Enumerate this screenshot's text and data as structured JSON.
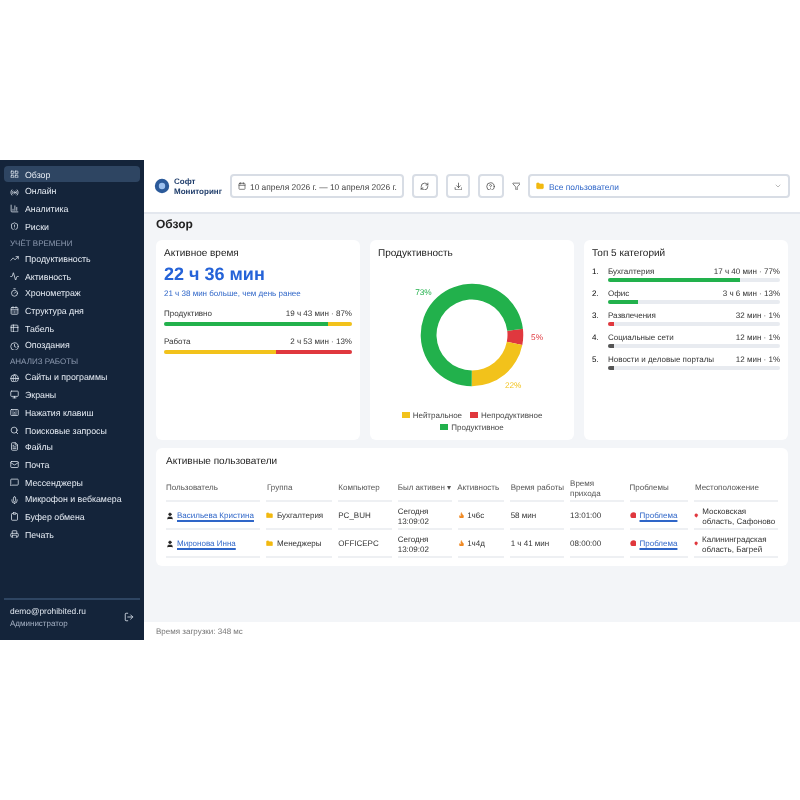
{
  "sidebar": {
    "items": [
      {
        "label": "Обзор",
        "selected": true
      },
      {
        "label": "Онлайн",
        "selected": false
      },
      {
        "label": "Аналитика",
        "selected": false
      },
      {
        "label": "Риски",
        "selected": false
      }
    ],
    "sections": [
      {
        "title": "УЧЁТ ВРЕМЕНИ",
        "items": [
          {
            "label": "Продуктивность",
            "selected": false
          },
          {
            "label": "Активность",
            "selected": false
          },
          {
            "label": "Хронометраж",
            "selected": false
          },
          {
            "label": "Структура дня",
            "selected": false
          },
          {
            "label": "Табель",
            "selected": false
          },
          {
            "label": "Опоздания",
            "selected": false
          }
        ]
      },
      {
        "title": "АНАЛИЗ РАБОТЫ",
        "items": [
          {
            "label": "Сайты и программы",
            "selected": false
          },
          {
            "label": "Экраны",
            "selected": false
          },
          {
            "label": "Нажатия клавиш",
            "selected": false
          },
          {
            "label": "Поисковые запросы",
            "selected": false
          },
          {
            "label": "Файлы",
            "selected": false
          },
          {
            "label": "Почта",
            "selected": false
          },
          {
            "label": "Мессенджеры",
            "selected": false
          },
          {
            "label": "Микрофон и вебкамера",
            "selected": false
          },
          {
            "label": "Буфер обмена",
            "selected": false
          },
          {
            "label": "Печать",
            "selected": false
          }
        ]
      }
    ],
    "user": {
      "email": "demo@prohibited.ru",
      "role": "Администратор"
    }
  },
  "toolbar": {
    "logo": [
      "Софт",
      "Мониторинг"
    ],
    "date_range": "10 апреля 2026 г. — 10 апреля 2026 г.",
    "filter": "Все пользователи"
  },
  "page_title": "Обзор",
  "active_time": {
    "title": "Активное время",
    "value": "22 ч 36 мин",
    "note": "21 ч 38 мин больше, чем день ранее",
    "bars": [
      {
        "label": "Продуктивно",
        "reading": "19 ч 43 мин · 87%",
        "segments": [
          {
            "level": 0.87,
            "color": "#22b14c"
          },
          {
            "level": 0.13,
            "color": "#f2c21b"
          }
        ]
      },
      {
        "label": "Работа",
        "reading": "2 ч 53 мин · 13%",
        "segments": [
          {
            "level": 0.6,
            "color": "#f2c21b"
          },
          {
            "level": 0.4,
            "color": "#e0383e"
          }
        ]
      }
    ]
  },
  "productivity": {
    "title": "Продуктивность",
    "chart_data": {
      "type": "donut",
      "categories": [
        "Нейтральное",
        "Непродуктивное",
        "Продуктивное"
      ],
      "values": [
        22,
        5,
        73
      ],
      "colors": [
        "#f2c21b",
        "#e0383e",
        "#22b14c"
      ],
      "data_labels": true,
      "value_labels": [
        "22%",
        "5%",
        "73%"
      ]
    }
  },
  "top_categories": {
    "title": "Топ 5 категорий",
    "items": [
      {
        "rank": "1.",
        "name": "Бухгалтерия",
        "reading": "17 ч 40 мин · 77%",
        "level": 0.77,
        "color": "#22b14c"
      },
      {
        "rank": "2.",
        "name": "Офис",
        "reading": "3 ч 6 мин · 13%",
        "level": 0.17,
        "color": "#22b14c"
      },
      {
        "rank": "3.",
        "name": "Развлечения",
        "reading": "32 мин · 1%",
        "level": 0.03,
        "color": "#e0383e"
      },
      {
        "rank": "4.",
        "name": "Социальные сети",
        "reading": "12 мин · 1%",
        "level": 0.01,
        "color": "#555555"
      },
      {
        "rank": "5.",
        "name": "Новости и деловые порталы",
        "reading": "12 мин · 1%",
        "level": 0.01,
        "color": "#555555"
      }
    ]
  },
  "users_table": {
    "title": "Активные пользователи",
    "columns": [
      "Пользователь",
      "Группа",
      "Компьютер",
      "Был активен ▾",
      "Активность",
      "Время работы",
      "Время прихода",
      "Проблемы",
      "Местоположение"
    ],
    "rows": [
      [
        "Васильева Кристина",
        "Бухгалтерия",
        "PC_BUH",
        "Сегодня 13:09:02",
        "1ч6с",
        "58 мин",
        "13:01:00",
        "Проблема",
        "Московская область, Сафоново"
      ],
      [
        "Миронова Инна",
        "Менеджеры",
        "OFFICEPC",
        "Сегодня 13:09:02",
        "1ч4д",
        "1 ч 41 мин",
        "08:00:00",
        "Проблема",
        "Калининградская область, Багрей"
      ]
    ]
  },
  "status_bar": "Время загрузки: 348 мс"
}
